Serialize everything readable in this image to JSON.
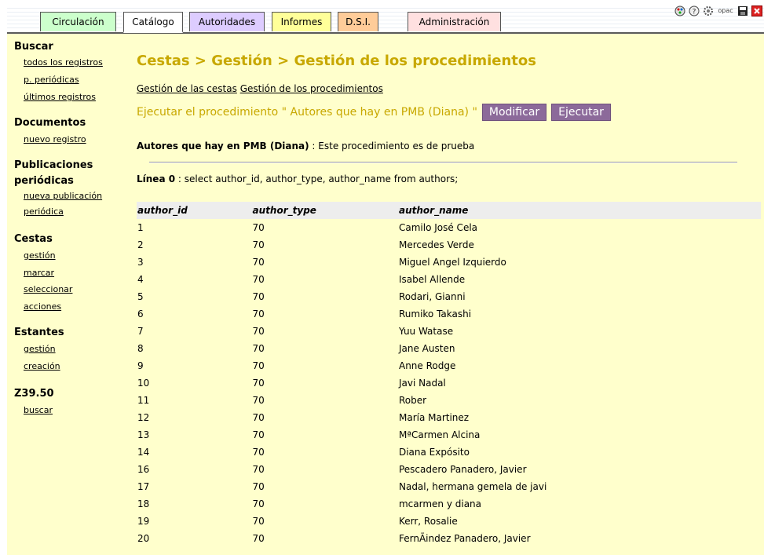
{
  "tabs": [
    {
      "label": "Circulación",
      "color": "#ccffcc"
    },
    {
      "label": "Catálogo",
      "color": "#ffffff"
    },
    {
      "label": "Autoridades",
      "color": "#ddccff"
    },
    {
      "label": "Informes",
      "color": "#ffff99"
    },
    {
      "label": "D.S.I.",
      "color": "#ffcc99"
    },
    {
      "label": "Administración",
      "color": "#ffe0e0"
    }
  ],
  "top_icons": [
    "palette-icon",
    "help-icon",
    "gear-icon",
    "opac-icon",
    "save-icon",
    "close-icon"
  ],
  "top_icons_text": {
    "opac": "opac"
  },
  "sidebar": {
    "buscar": {
      "title": "Buscar",
      "links": [
        "todos los registros",
        "p. periódicas",
        "últimos registros"
      ]
    },
    "documentos": {
      "title": "Documentos",
      "links": [
        "nuevo registro"
      ]
    },
    "publicaciones": {
      "title_line1": "Publicaciones",
      "title_line2": "periódicas",
      "link_line1": "nueva publicación",
      "link_line2": "periódica"
    },
    "cestas": {
      "title": "Cestas",
      "links": [
        "gestión",
        "marcar",
        "seleccionar",
        "acciones"
      ]
    },
    "estantes": {
      "title": "Estantes",
      "links": [
        "gestión",
        "creación"
      ]
    },
    "z3950": {
      "title": "Z39.50",
      "links": [
        "buscar"
      ]
    }
  },
  "main": {
    "title": "Cestas > Gestión > Gestión de los procedimientos",
    "subnav": [
      "Gestión de las cestas",
      "Gestión de los procedimientos"
    ],
    "exec_text": "Ejecutar el procedimiento \" Autores que hay en PMB (Diana) \"",
    "btn_modify": "Modificar",
    "btn_execute": "Ejecutar",
    "proc_name": "Autores que hay en PMB (Diana)",
    "proc_desc": " : Este procedimiento es de prueba",
    "query_label": "Línea 0",
    "query_text": " : select author_id, author_type, author_name from authors;"
  },
  "table": {
    "headers": [
      "author_id",
      "author_type",
      "author_name"
    ],
    "rows": [
      [
        "1",
        "70",
        "Camilo José Cela"
      ],
      [
        "2",
        "70",
        "Mercedes Verde"
      ],
      [
        "3",
        "70",
        "Miguel Angel Izquierdo"
      ],
      [
        "4",
        "70",
        "Isabel Allende"
      ],
      [
        "5",
        "70",
        "Rodari, Gianni"
      ],
      [
        "6",
        "70",
        "Rumiko Takashi"
      ],
      [
        "7",
        "70",
        "Yuu Watase"
      ],
      [
        "8",
        "70",
        "Jane Austen"
      ],
      [
        "9",
        "70",
        "Anne Rodge"
      ],
      [
        "10",
        "70",
        "Javi Nadal"
      ],
      [
        "11",
        "70",
        "Rober"
      ],
      [
        "12",
        "70",
        "María Martinez"
      ],
      [
        "13",
        "70",
        "MªCarmen Alcina"
      ],
      [
        "14",
        "70",
        "Diana Expósito"
      ],
      [
        "16",
        "70",
        "Pescadero Panadero, Javier"
      ],
      [
        "17",
        "70",
        "Nadal, hermana gemela de javi"
      ],
      [
        "18",
        "70",
        "mcarmen y diana"
      ],
      [
        "19",
        "70",
        "Kerr, Rosalie"
      ],
      [
        "20",
        "70",
        "FernÃindez Panadero, Javier"
      ]
    ]
  }
}
